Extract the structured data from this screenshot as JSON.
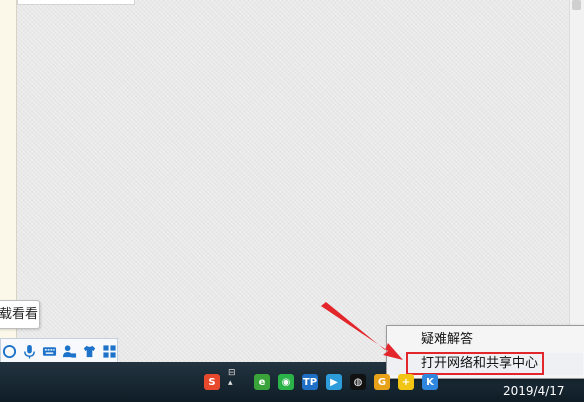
{
  "tooltip": {
    "text": "载看看"
  },
  "ime_toolbar": {
    "icons": [
      "info-icon",
      "microphone-icon",
      "keyboard-icon",
      "user-tools-icon",
      "skin-shirt-icon",
      "grid-menu-icon"
    ]
  },
  "context_menu": {
    "items": [
      {
        "label": "疑难解答"
      },
      {
        "label": "打开网络和共享中心"
      }
    ],
    "highlighted_index": 1
  },
  "taskbar": {
    "tray_icons": [
      {
        "name": "sogou-ime-icon",
        "glyph": "S",
        "color": "#e8492c"
      },
      {
        "name": "green-circle-icon",
        "glyph": "e",
        "color": "#3aa43a"
      },
      {
        "name": "wechat-icon",
        "glyph": "◉",
        "color": "#2bb34a"
      },
      {
        "name": "tp-icon",
        "glyph": "TP",
        "color": "#1f6fc7"
      },
      {
        "name": "play-icon",
        "glyph": "▶",
        "color": "#2c9cdb"
      },
      {
        "name": "qq-icon",
        "glyph": "◍",
        "color": "#111111"
      },
      {
        "name": "g-icon",
        "glyph": "G",
        "color": "#e8a21a"
      },
      {
        "name": "security-plus-icon",
        "glyph": "+",
        "color": "#f2c515"
      },
      {
        "name": "k-icon",
        "glyph": "K",
        "color": "#2e86de"
      }
    ],
    "clock": {
      "date": "2019/4/17"
    }
  },
  "colors": {
    "taskbar": "#182833",
    "highlight_border": "#e3262b",
    "ime_icon": "#1d73c9"
  }
}
